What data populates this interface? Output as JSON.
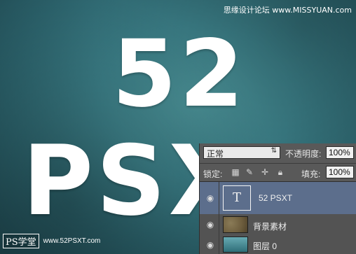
{
  "canvas": {
    "line1": "52",
    "line2": "PSXT",
    "watermark": "思缘设计论坛 www.MISSYUAN.com",
    "badge_brand": "PS学堂",
    "badge_url": "www.52PSXT.com"
  },
  "layers_panel": {
    "blend_mode": "正常",
    "opacity_label": "不透明度:",
    "opacity_value": "100%",
    "lock_label": "锁定:",
    "lock_icons": [
      "lock-transparent-icon",
      "lock-paint-icon",
      "lock-move-icon",
      "lock-all-icon"
    ],
    "fill_label": "填充:",
    "fill_value": "100%",
    "layers": [
      {
        "name": "52 PSXT",
        "type": "text",
        "selected": true,
        "thumb_glyph": "T"
      },
      {
        "name": "背景素材",
        "type": "texture",
        "selected": false
      },
      {
        "name": "图层 0",
        "type": "image",
        "selected": false
      }
    ]
  },
  "colors": {
    "canvas_teal": "#3c8089",
    "panel_bg": "#535353",
    "selected_layer": "#5c6e8c",
    "text_white": "#ffffff"
  }
}
